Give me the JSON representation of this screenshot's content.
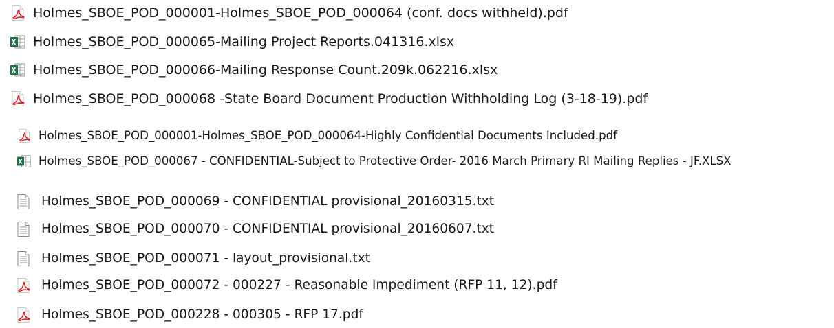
{
  "files": [
    {
      "name": "Holmes_SBOE_POD_000001-Holmes_SBOE_POD_000064 (conf. docs withheld).pdf",
      "icon": "pdf-icon"
    },
    {
      "name": "Holmes_SBOE_POD_000065-Mailing Project Reports.041316.xlsx",
      "icon": "excel-icon"
    },
    {
      "name": "Holmes_SBOE_POD_000066-Mailing Response Count.209k.062216.xlsx",
      "icon": "excel-icon"
    },
    {
      "name": "Holmes_SBOE_POD_000068 -State Board Document Production Withholding Log (3-18-19).pdf",
      "icon": "pdf-icon"
    },
    {
      "name": "Holmes_SBOE_POD_000001-Holmes_SBOE_POD_000064-Highly Confidential Documents Included.pdf",
      "icon": "pdf-icon"
    },
    {
      "name": "Holmes_SBOE_POD_000067 - CONFIDENTIAL-Subject to Protective Order- 2016 March Primary RI Mailing Replies - JF.XLSX",
      "icon": "excel-icon"
    },
    {
      "name": "Holmes_SBOE_POD_000069 - CONFIDENTIAL provisional_20160315.txt",
      "icon": "text-file-icon"
    },
    {
      "name": "Holmes_SBOE_POD_000070 - CONFIDENTIAL provisional_20160607.txt",
      "icon": "text-file-icon"
    },
    {
      "name": "Holmes_SBOE_POD_000071 - layout_provisional.txt",
      "icon": "text-file-icon"
    },
    {
      "name": "Holmes_SBOE_POD_000072 - 000227 - Reasonable Impediment (RFP 11, 12).pdf",
      "icon": "pdf-icon"
    },
    {
      "name": "Holmes_SBOE_POD_000228 - 000305 - RFP 17.pdf",
      "icon": "pdf-icon"
    }
  ],
  "colors": {
    "pdf_accent": "#d3262b",
    "excel_accent": "#1e7145",
    "text_icon_border": "#8a8a8a"
  }
}
